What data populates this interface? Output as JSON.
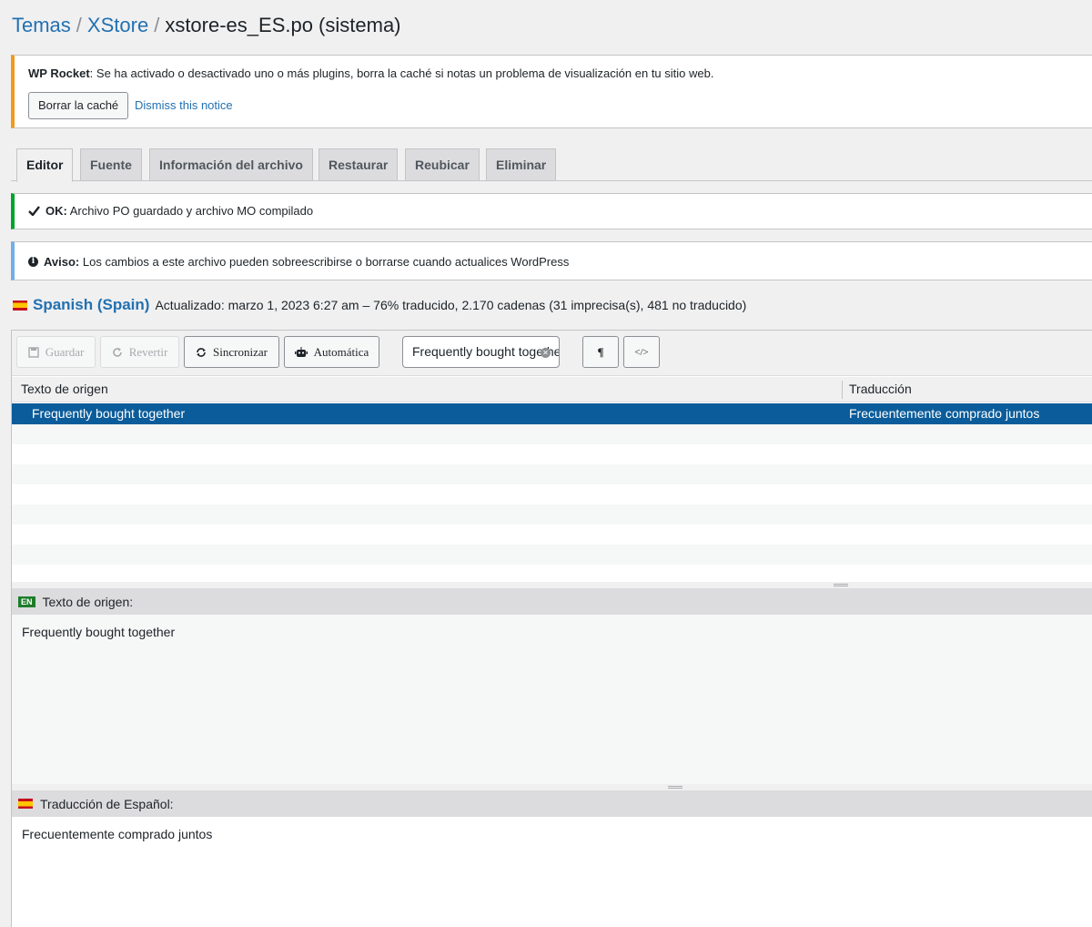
{
  "breadcrumb": {
    "root": "Temas",
    "parent": "XStore",
    "current": "xstore-es_ES.po (sistema)"
  },
  "rocket_notice": {
    "brand": "WP Rocket",
    "text": ": Se ha activado o desactivado uno o más plugins, borra la caché si notas un problema de visualización en tu sitio web.",
    "clear_button": "Borrar la caché",
    "dismiss": "Dismiss this notice"
  },
  "tabs": [
    "Editor",
    "Fuente",
    "Información del archivo",
    "Restaurar",
    "Reubicar",
    "Eliminar"
  ],
  "ok_notice": {
    "label": "OK:",
    "text": "Archivo PO guardado y archivo MO compilado"
  },
  "warn_notice": {
    "label": "Aviso:",
    "text": "Los cambios a este archivo pueden sobreescribirse o borrarse cuando actualices WordPress"
  },
  "language": {
    "name": "Spanish (Spain)",
    "stats": "Actualizado: marzo 1, 2023 6:27 am – 76% traducido, 2.170 cadenas (31 imprecisa(s), 481 no traducido)"
  },
  "toolbar": {
    "save": "Guardar",
    "revert": "Revertir",
    "sync": "Sincronizar",
    "auto": "Automática",
    "search_value": "Frequently bought together",
    "pilcrow": "¶",
    "code": "</>"
  },
  "table": {
    "col_source": "Texto de origen",
    "col_translation": "Traducción",
    "selected_source": "Frequently bought together",
    "selected_translation": "Frecuentemente comprado juntos"
  },
  "source_pane": {
    "badge": "EN",
    "label": "Texto de origen:",
    "text": "Frequently bought together"
  },
  "translation_pane": {
    "label": "Traducción de Español:",
    "text": "Frecuentemente comprado juntos"
  },
  "colors": {
    "link": "#2271b1",
    "selected_row": "#0b5c9a",
    "ok": "#00a32a",
    "warn": "#72aee6",
    "rocket": "#f29a1c"
  }
}
